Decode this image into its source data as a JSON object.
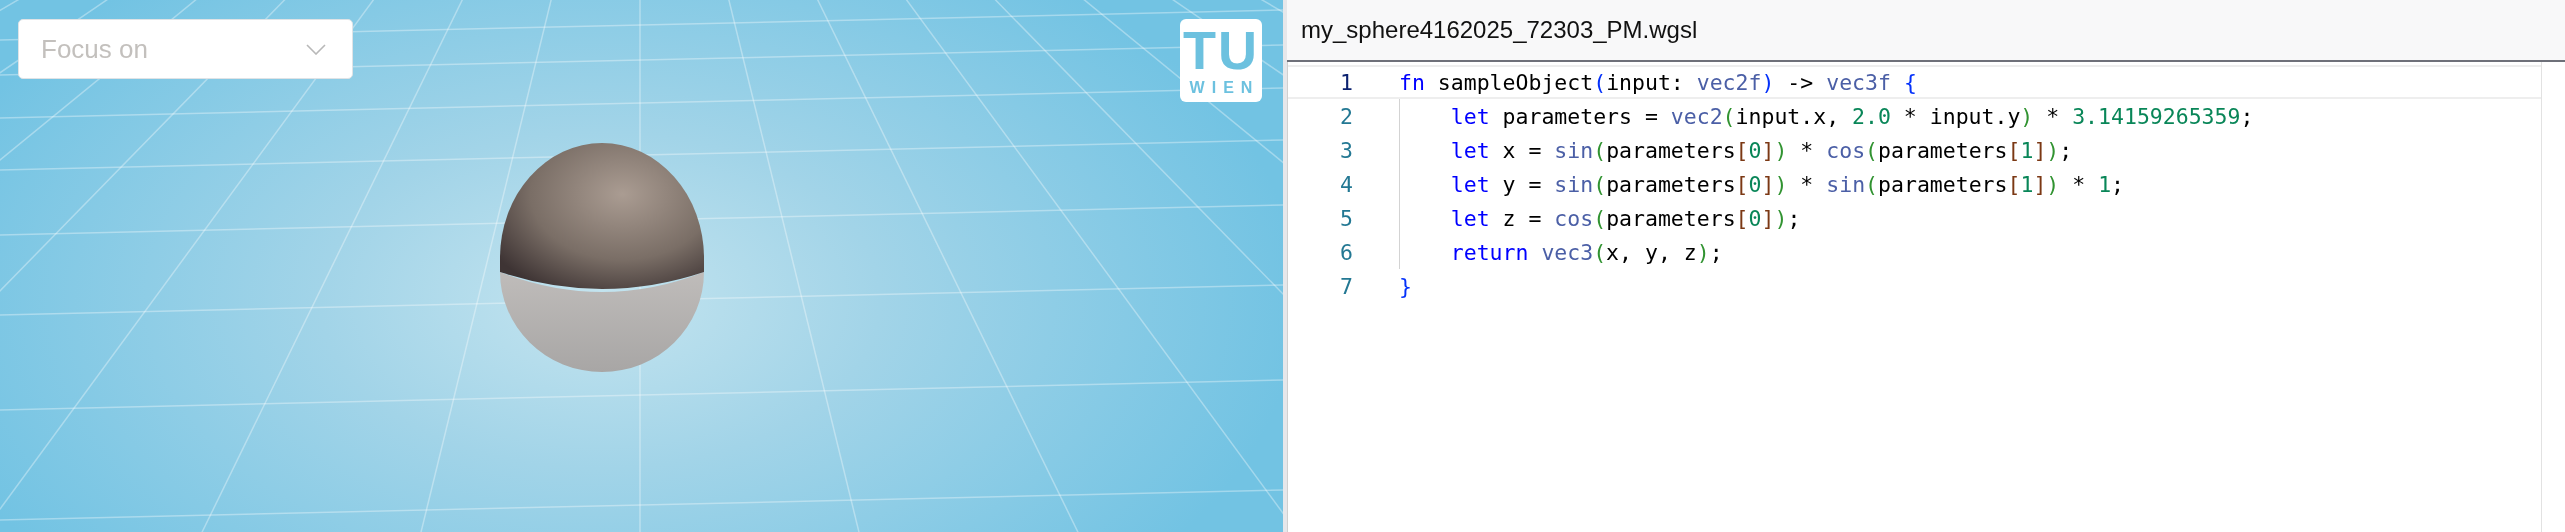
{
  "viewport": {
    "focus_select": {
      "placeholder": "Focus on"
    },
    "logo": {
      "lines": [
        "TU",
        "WIEN"
      ]
    }
  },
  "editor": {
    "filename": "my_sphere4162025_72303_PM.wgsl",
    "lines": [
      {
        "number": "1",
        "current": true,
        "indented": false,
        "tokens": [
          {
            "t": "fn",
            "kind": "kw"
          },
          {
            "t": " sampleObject",
            "kind": "plain"
          },
          {
            "t": "(",
            "kind": "b1"
          },
          {
            "t": "input: ",
            "kind": "plain"
          },
          {
            "t": "vec2f",
            "kind": "ty"
          },
          {
            "t": ")",
            "kind": "b1"
          },
          {
            "t": " -> ",
            "kind": "plain"
          },
          {
            "t": "vec3f ",
            "kind": "ty"
          },
          {
            "t": "{",
            "kind": "b1"
          }
        ]
      },
      {
        "number": "2",
        "current": false,
        "indented": true,
        "tokens": [
          {
            "t": "let",
            "kind": "kw"
          },
          {
            "t": " parameters = ",
            "kind": "plain"
          },
          {
            "t": "vec2",
            "kind": "ty"
          },
          {
            "t": "(",
            "kind": "b2"
          },
          {
            "t": "input.x, ",
            "kind": "plain"
          },
          {
            "t": "2.0",
            "kind": "num"
          },
          {
            "t": " * input.y",
            "kind": "plain"
          },
          {
            "t": ")",
            "kind": "b2"
          },
          {
            "t": " * ",
            "kind": "plain"
          },
          {
            "t": "3.14159265359",
            "kind": "num"
          },
          {
            "t": ";",
            "kind": "plain"
          }
        ]
      },
      {
        "number": "3",
        "current": false,
        "indented": true,
        "tokens": [
          {
            "t": "let",
            "kind": "kw"
          },
          {
            "t": " x = ",
            "kind": "plain"
          },
          {
            "t": "sin",
            "kind": "ty"
          },
          {
            "t": "(",
            "kind": "b2"
          },
          {
            "t": "parameters",
            "kind": "plain"
          },
          {
            "t": "[",
            "kind": "b3"
          },
          {
            "t": "0",
            "kind": "num"
          },
          {
            "t": "]",
            "kind": "b3"
          },
          {
            "t": ")",
            "kind": "b2"
          },
          {
            "t": " * ",
            "kind": "plain"
          },
          {
            "t": "cos",
            "kind": "ty"
          },
          {
            "t": "(",
            "kind": "b2"
          },
          {
            "t": "parameters",
            "kind": "plain"
          },
          {
            "t": "[",
            "kind": "b3"
          },
          {
            "t": "1",
            "kind": "num"
          },
          {
            "t": "]",
            "kind": "b3"
          },
          {
            "t": ")",
            "kind": "b2"
          },
          {
            "t": ";",
            "kind": "plain"
          }
        ]
      },
      {
        "number": "4",
        "current": false,
        "indented": true,
        "tokens": [
          {
            "t": "let",
            "kind": "kw"
          },
          {
            "t": " y = ",
            "kind": "plain"
          },
          {
            "t": "sin",
            "kind": "ty"
          },
          {
            "t": "(",
            "kind": "b2"
          },
          {
            "t": "parameters",
            "kind": "plain"
          },
          {
            "t": "[",
            "kind": "b3"
          },
          {
            "t": "0",
            "kind": "num"
          },
          {
            "t": "]",
            "kind": "b3"
          },
          {
            "t": ")",
            "kind": "b2"
          },
          {
            "t": " * ",
            "kind": "plain"
          },
          {
            "t": "sin",
            "kind": "ty"
          },
          {
            "t": "(",
            "kind": "b2"
          },
          {
            "t": "parameters",
            "kind": "plain"
          },
          {
            "t": "[",
            "kind": "b3"
          },
          {
            "t": "1",
            "kind": "num"
          },
          {
            "t": "]",
            "kind": "b3"
          },
          {
            "t": ")",
            "kind": "b2"
          },
          {
            "t": " * ",
            "kind": "plain"
          },
          {
            "t": "1",
            "kind": "num"
          },
          {
            "t": ";",
            "kind": "plain"
          }
        ]
      },
      {
        "number": "5",
        "current": false,
        "indented": true,
        "tokens": [
          {
            "t": "let",
            "kind": "kw"
          },
          {
            "t": " z = ",
            "kind": "plain"
          },
          {
            "t": "cos",
            "kind": "ty"
          },
          {
            "t": "(",
            "kind": "b2"
          },
          {
            "t": "parameters",
            "kind": "plain"
          },
          {
            "t": "[",
            "kind": "b3"
          },
          {
            "t": "0",
            "kind": "num"
          },
          {
            "t": "]",
            "kind": "b3"
          },
          {
            "t": ")",
            "kind": "b2"
          },
          {
            "t": ";",
            "kind": "plain"
          }
        ]
      },
      {
        "number": "6",
        "current": false,
        "indented": true,
        "tokens": [
          {
            "t": "return ",
            "kind": "kw"
          },
          {
            "t": "vec3",
            "kind": "ty"
          },
          {
            "t": "(",
            "kind": "b2"
          },
          {
            "t": "x, y, z",
            "kind": "plain"
          },
          {
            "t": ")",
            "kind": "b2"
          },
          {
            "t": ";",
            "kind": "plain"
          }
        ]
      },
      {
        "number": "7",
        "current": false,
        "indented": false,
        "tokens": [
          {
            "t": "}",
            "kind": "b1"
          }
        ]
      }
    ]
  }
}
